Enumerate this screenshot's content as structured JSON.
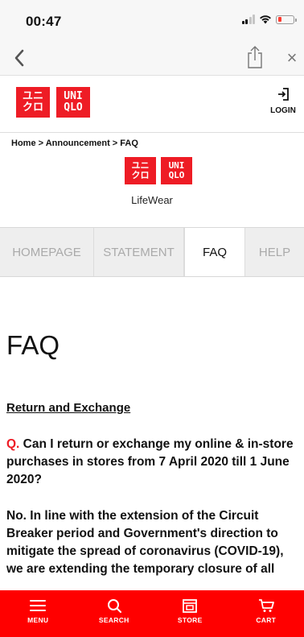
{
  "status_bar": {
    "time": "00:47"
  },
  "browser": {},
  "header": {
    "logo": {
      "tl": "ユニ",
      "tr": "UNI",
      "bl": "クロ",
      "br": "QLO"
    },
    "login_label": "LOGIN"
  },
  "breadcrumb": "Home > Announcement > FAQ",
  "brand_tagline": "LifeWear",
  "tabs": [
    {
      "label": "HOMEPAGE",
      "active": false
    },
    {
      "label": "STATEMENT",
      "active": false
    },
    {
      "label": "FAQ",
      "active": true
    },
    {
      "label": "HELP",
      "active": false
    }
  ],
  "main": {
    "title": "FAQ",
    "section_heading": "Return and Exchange",
    "question_marker": "Q.",
    "question_text": " Can I return or exchange my online & in-store purchases in stores from 7 April 2020 till 1 June 2020?",
    "answer_text": "No. In line with the extension of the Circuit Breaker period and Government's direction to mitigate the spread of coronavirus (COVID-19), we are extending the temporary closure of all"
  },
  "bottom_nav": [
    {
      "label": "MENU",
      "icon": "menu-icon"
    },
    {
      "label": "SEARCH",
      "icon": "search-icon"
    },
    {
      "label": "STORE",
      "icon": "store-icon"
    },
    {
      "label": "CART",
      "icon": "cart-icon"
    }
  ],
  "colors": {
    "brand_red": "#ee1c25",
    "nav_red": "#ff0000"
  }
}
